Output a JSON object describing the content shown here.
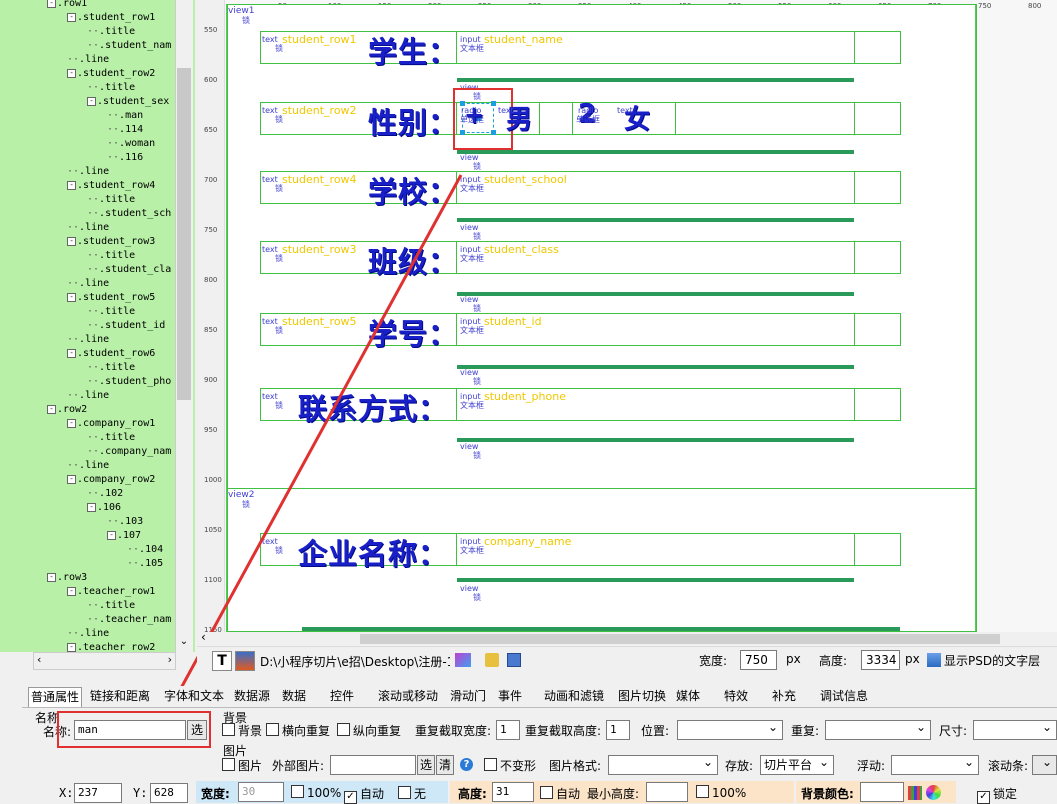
{
  "tree": {
    "nodes": [
      {
        "label": "row1",
        "indent": 0,
        "box": "-"
      },
      {
        "label": "student_row1",
        "indent": 1,
        "box": "-"
      },
      {
        "label": "title",
        "indent": 2,
        "box": ""
      },
      {
        "label": "student_nam",
        "indent": 2,
        "box": ""
      },
      {
        "label": "line",
        "indent": 1,
        "box": ""
      },
      {
        "label": "student_row2",
        "indent": 1,
        "box": "-"
      },
      {
        "label": "title",
        "indent": 2,
        "box": ""
      },
      {
        "label": "student_sex",
        "indent": 2,
        "box": "-"
      },
      {
        "label": "man",
        "indent": 3,
        "box": ""
      },
      {
        "label": "114",
        "indent": 3,
        "box": ""
      },
      {
        "label": "woman",
        "indent": 3,
        "box": ""
      },
      {
        "label": "116",
        "indent": 3,
        "box": ""
      },
      {
        "label": "line",
        "indent": 1,
        "box": ""
      },
      {
        "label": "student_row4",
        "indent": 1,
        "box": "-"
      },
      {
        "label": "title",
        "indent": 2,
        "box": ""
      },
      {
        "label": "student_sch",
        "indent": 2,
        "box": ""
      },
      {
        "label": "line",
        "indent": 1,
        "box": ""
      },
      {
        "label": "student_row3",
        "indent": 1,
        "box": "-"
      },
      {
        "label": "title",
        "indent": 2,
        "box": ""
      },
      {
        "label": "student_cla",
        "indent": 2,
        "box": ""
      },
      {
        "label": "line",
        "indent": 1,
        "box": ""
      },
      {
        "label": "student_row5",
        "indent": 1,
        "box": "-"
      },
      {
        "label": "title",
        "indent": 2,
        "box": ""
      },
      {
        "label": "student_id",
        "indent": 2,
        "box": ""
      },
      {
        "label": "line",
        "indent": 1,
        "box": ""
      },
      {
        "label": "student_row6",
        "indent": 1,
        "box": "-"
      },
      {
        "label": "title",
        "indent": 2,
        "box": ""
      },
      {
        "label": "student_pho",
        "indent": 2,
        "box": ""
      },
      {
        "label": "line",
        "indent": 1,
        "box": ""
      },
      {
        "label": "row2",
        "indent": 0,
        "box": "-"
      },
      {
        "label": "company_row1",
        "indent": 1,
        "box": "-"
      },
      {
        "label": "title",
        "indent": 2,
        "box": ""
      },
      {
        "label": "company_nam",
        "indent": 2,
        "box": ""
      },
      {
        "label": "line",
        "indent": 1,
        "box": ""
      },
      {
        "label": "company_row2",
        "indent": 1,
        "box": "-"
      },
      {
        "label": "102",
        "indent": 2,
        "box": ""
      },
      {
        "label": "106",
        "indent": 2,
        "box": "-"
      },
      {
        "label": "103",
        "indent": 3,
        "box": ""
      },
      {
        "label": "107",
        "indent": 3,
        "box": "-"
      },
      {
        "label": "104",
        "indent": 4,
        "box": ""
      },
      {
        "label": "105",
        "indent": 4,
        "box": ""
      },
      {
        "label": "row3",
        "indent": 0,
        "box": "-"
      },
      {
        "label": "teacher_row1",
        "indent": 1,
        "box": "-"
      },
      {
        "label": "title",
        "indent": 2,
        "box": ""
      },
      {
        "label": "teacher_nam",
        "indent": 2,
        "box": ""
      },
      {
        "label": "line",
        "indent": 1,
        "box": ""
      },
      {
        "label": "teacher_row2",
        "indent": 1,
        "box": "-"
      }
    ]
  },
  "rulers": {
    "vertical": [
      "550",
      "600",
      "650",
      "700",
      "750",
      "800",
      "850",
      "900",
      "950",
      "1000",
      "1050",
      "1100",
      "1150"
    ],
    "horizontal": [
      "50",
      "100",
      "150",
      "200",
      "250",
      "300",
      "350",
      "400",
      "450",
      "500",
      "550",
      "600",
      "650",
      "700",
      "750",
      "800"
    ]
  },
  "canvas": {
    "view1": "view1",
    "view2": "view2",
    "view_small": "view",
    "lock_char": "锁",
    "text_tag": "text",
    "input_tag": "input",
    "input_sub": "文本框",
    "radio_tag": "radio",
    "radio_sub": "单选框",
    "rows": [
      {
        "yellow": "student_row1",
        "big": "学生：",
        "field": "student_name"
      },
      {
        "yellow": "student_row2",
        "big": "性别：",
        "field": ""
      },
      {
        "yellow": "student_row4",
        "big": "学校：",
        "field": "student_school"
      },
      {
        "yellow": "student_row3",
        "big": "班级：",
        "field": "student_class"
      },
      {
        "yellow": "student_row5",
        "big": "学号：",
        "field": "student_id"
      },
      {
        "yellow": "",
        "big": "联系方式：",
        "field": "student_phone"
      },
      {
        "yellow": "",
        "big": "企业名称：",
        "field": "company_name"
      }
    ],
    "radio_male": "男",
    "radio_female": "女",
    "radio_num": "2"
  },
  "status": {
    "path": "D:\\小程序切片\\e招\\Desktop\\注册-1",
    "width_label": "宽度:",
    "width_value": "750",
    "px1": "px",
    "height_label": "高度:",
    "height_value": "3334",
    "px2": "px",
    "psd_text": "显示PSD的文字层"
  },
  "tabs": [
    "普通属性",
    "链接和距离",
    "字体和文本",
    "数据源",
    "数据",
    "控件",
    "滚动或移动",
    "滑动门",
    "事件",
    "动画和滤镜",
    "图片切换",
    "媒体",
    "特效",
    "补充",
    "调试信息"
  ],
  "props": {
    "name_group": "名称",
    "name_label": "名称:",
    "name_value": "man",
    "select_btn": "选",
    "bg_group": "背景",
    "bg_check": "背景",
    "h_repeat": "横向重复",
    "v_repeat": "纵向重复",
    "repeat_w_label": "重复截取宽度:",
    "repeat_w_value": "1",
    "repeat_h_label": "重复截取高度:",
    "repeat_h_value": "1",
    "position_label": "位置:",
    "repeat_label": "重复:",
    "size_label": "尺寸:",
    "image_group": "图片",
    "image_check": "图片",
    "external_label": "外部图片:",
    "select_btn2": "选",
    "clear_btn": "清",
    "no_deform": "不变形",
    "format_label": "图片格式:",
    "store_label": "存放:",
    "store_value": "切片平台",
    "float_label": "浮动:",
    "scroll_label": "滚动条:"
  },
  "bottom": {
    "x_label": "X:",
    "x_value": "237",
    "y_label": "Y:",
    "y_value": "628",
    "w_label": "宽度:",
    "w_value": "30",
    "pct1": "100%",
    "auto1": "自动",
    "none": "无",
    "h_label": "高度:",
    "h_value": "31",
    "auto2": "自动",
    "min_h_label": "最小高度:",
    "pct2": "100%",
    "bgcolor_label": "背景颜色:",
    "lock": "锁定"
  },
  "colors": {
    "tree_bg": "#b8f0a8",
    "accent_blue": "#1a20c8",
    "annotation_red": "#e03030",
    "guide_green": "#40c040"
  }
}
